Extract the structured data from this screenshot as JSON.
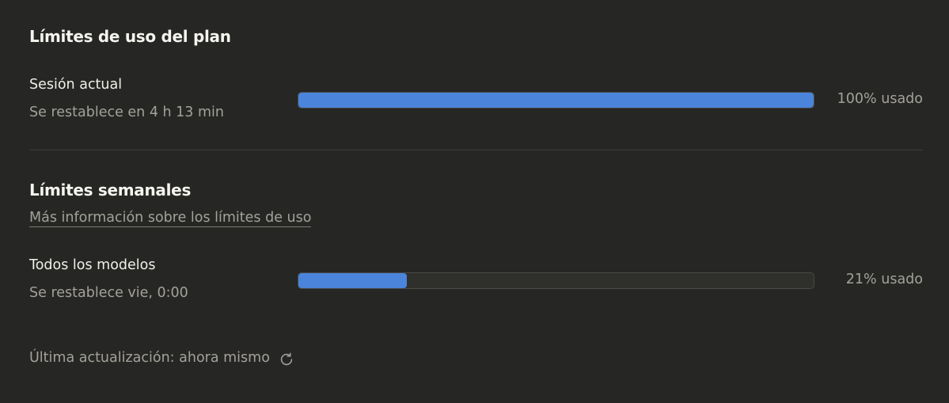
{
  "plan_limits": {
    "title": "Límites de uso del plan",
    "session": {
      "label": "Sesión actual",
      "reset": "Se restablece en 4 h 13 min",
      "usage_text": "100% usado",
      "usage_fraction": 1.0
    }
  },
  "weekly_limits": {
    "title": "Límites semanales",
    "info_link": "Más información sobre los límites de uso",
    "all_models": {
      "label": "Todos los modelos",
      "reset": "Se restablece vie, 0:00",
      "usage_text": "21% usado",
      "usage_fraction": 0.21
    }
  },
  "footer": {
    "last_updated": "Última actualización: ahora mismo",
    "refresh_icon": "refresh-icon"
  },
  "colors": {
    "background": "#262624",
    "bar_fill": "#4a84db",
    "bar_track": "#2f2f2c"
  }
}
